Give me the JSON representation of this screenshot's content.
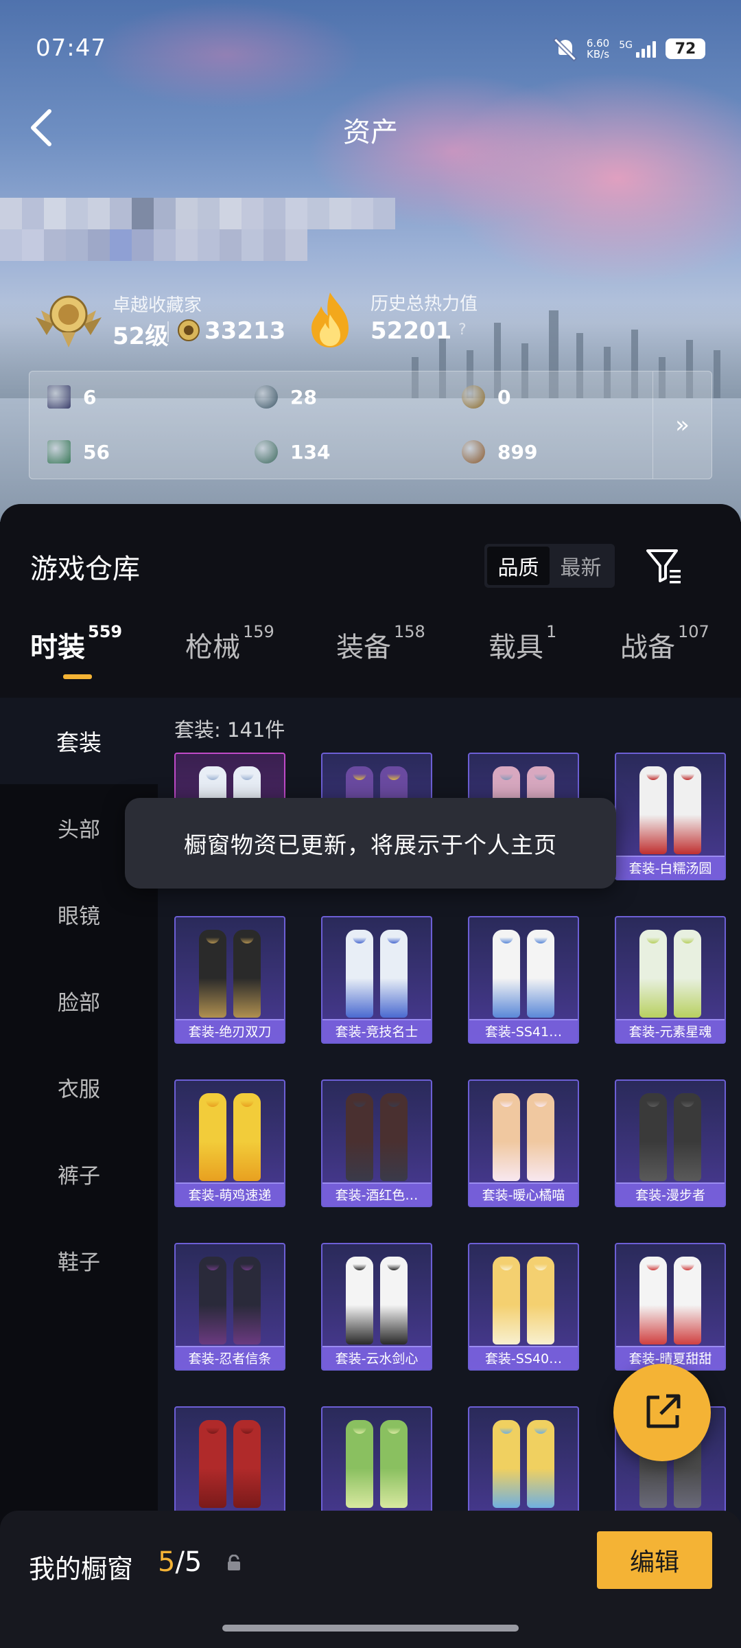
{
  "status": {
    "time": "07:47",
    "net_speed_value": "6.60",
    "net_speed_unit": "KB/s",
    "network": "5G",
    "battery": "72"
  },
  "header": {
    "title": "资产"
  },
  "profile": {
    "collector_label": "卓越收藏家",
    "collector_level": "52级",
    "coin_value": "33213",
    "heat_label": "历史总热力值",
    "heat_value": "52201",
    "help": "?"
  },
  "resources": [
    {
      "value": "6",
      "icon": "card-icon",
      "color": "#3b3f6b"
    },
    {
      "value": "28",
      "icon": "silver-coin-icon",
      "color": "#3c5666"
    },
    {
      "value": "0",
      "icon": "gold-coin-icon",
      "color": "#8a6a2a"
    },
    {
      "value": "56",
      "icon": "green-card-icon",
      "color": "#3b7a5a"
    },
    {
      "value": "134",
      "icon": "jade-coin-icon",
      "color": "#3d6a5e"
    },
    {
      "value": "899",
      "icon": "bronze-coin-icon",
      "color": "#8a5a2e"
    }
  ],
  "resources_more": "»",
  "warehouse": {
    "title": "游戏仓库",
    "sort_options": [
      "品质",
      "最新"
    ],
    "tabs": [
      {
        "label": "时装",
        "count": "559"
      },
      {
        "label": "枪械",
        "count": "159"
      },
      {
        "label": "装备",
        "count": "158"
      },
      {
        "label": "载具",
        "count": "1"
      },
      {
        "label": "战备",
        "count": "107"
      }
    ],
    "sidebar": [
      "套装",
      "头部",
      "眼镜",
      "脸部",
      "衣服",
      "裤子",
      "鞋子"
    ],
    "suit_count": "套装: 141件",
    "items": [
      {
        "caption": "",
        "c1": "#e8eef6",
        "c2": "#9fb4d4"
      },
      {
        "caption": "",
        "c1": "#6a4aa0",
        "c2": "#d9b34a"
      },
      {
        "caption": "",
        "c1": "#d8a8c0",
        "c2": "#8a9ab8"
      },
      {
        "caption": "套装-白糯汤圆",
        "c1": "#f0f0f0",
        "c2": "#c03030"
      },
      {
        "caption": "套装-绝刃双刀",
        "c1": "#2a2a2a",
        "c2": "#b09050"
      },
      {
        "caption": "套装-竞技名士",
        "c1": "#e8eef6",
        "c2": "#4a6ad0"
      },
      {
        "caption": "套装-SS41…",
        "c1": "#f4f4f4",
        "c2": "#5a88d8"
      },
      {
        "caption": "套装-元素星魂",
        "c1": "#e8f0e0",
        "c2": "#b8d060"
      },
      {
        "caption": "套装-萌鸡速递",
        "c1": "#f2cc3a",
        "c2": "#e8a020"
      },
      {
        "caption": "套装-酒红色…",
        "c1": "#4a3030",
        "c2": "#3a3a4a"
      },
      {
        "caption": "套装-暖心橘喵",
        "c1": "#f0c8a0",
        "c2": "#f8e8f0"
      },
      {
        "caption": "套装-漫步者",
        "c1": "#3a3a3a",
        "c2": "#5a5a5a"
      },
      {
        "caption": "套装-忍者信条",
        "c1": "#2a2a3a",
        "c2": "#6a3a80"
      },
      {
        "caption": "套装-云水剑心",
        "c1": "#f4f4f4",
        "c2": "#2a2a2a"
      },
      {
        "caption": "套装-SS40…",
        "c1": "#f4d070",
        "c2": "#f8f0d0"
      },
      {
        "caption": "套装-晴夏甜甜",
        "c1": "#f4f4f4",
        "c2": "#d04040"
      },
      {
        "caption": "",
        "c1": "#b02a2a",
        "c2": "#7a1a1a"
      },
      {
        "caption": "",
        "c1": "#8ac060",
        "c2": "#d8e8a0"
      },
      {
        "caption": "",
        "c1": "#f0d060",
        "c2": "#70b0e0"
      },
      {
        "caption": "",
        "c1": "#4a4a4a",
        "c2": "#6a6a7a"
      }
    ]
  },
  "toast": "橱窗物资已更新，将展示于个人主页",
  "bottom": {
    "window_label": "我的橱窗",
    "window_current": "5",
    "window_total": "/5",
    "edit_label": "编辑"
  },
  "colors": {
    "accent": "#f4b335",
    "panel": "#0f1016",
    "card_border": "#6d5fd6"
  }
}
